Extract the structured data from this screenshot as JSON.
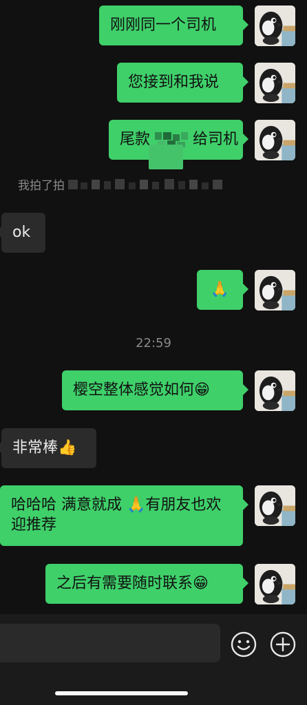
{
  "messages": [
    {
      "id": "m1",
      "side": "out",
      "text": "刚刚同一个司机"
    },
    {
      "id": "m2",
      "side": "out",
      "text": "您接到和我说"
    },
    {
      "id": "m3",
      "side": "out",
      "text_start": "尾款",
      "text_end": "给司机"
    },
    {
      "id": "m4",
      "side": "in",
      "text": "ok"
    },
    {
      "id": "m5",
      "side": "out",
      "text": "🙏"
    },
    {
      "id": "m6",
      "side": "out",
      "text": "樱空整体感觉如何😁"
    },
    {
      "id": "m7",
      "side": "in",
      "text": "非常棒👍"
    },
    {
      "id": "m8",
      "side": "out",
      "text": "哈哈哈 满意就成 🙏有朋友也欢迎推荐"
    },
    {
      "id": "m9",
      "side": "out",
      "text": "之后有需要随时联系😁"
    }
  ],
  "system_notice": {
    "text": "我拍了拍"
  },
  "timestamp": "22:59",
  "input_bar": {
    "emoji_icon": "smiley-face-icon",
    "plus_icon": "plus-circle-icon"
  },
  "colors": {
    "outgoing_bubble": "#3fd06a",
    "incoming_bubble": "#2b2b2b",
    "background": "#111111"
  }
}
